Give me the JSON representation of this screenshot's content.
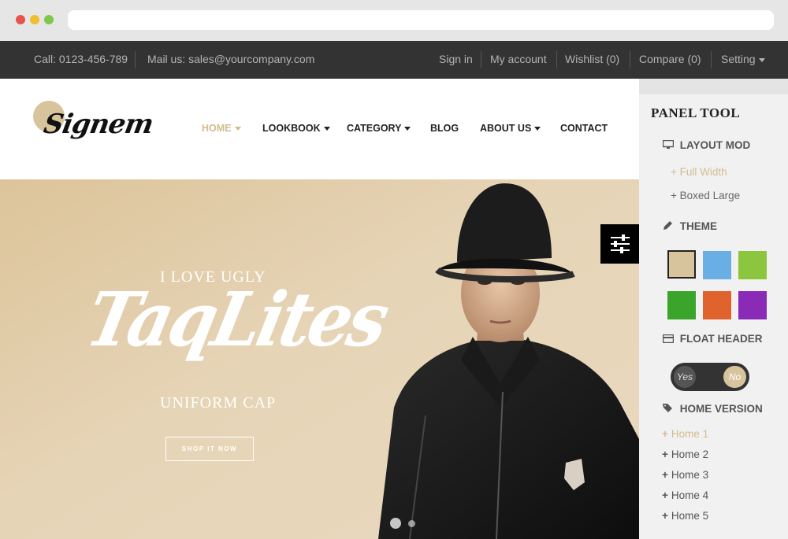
{
  "topbar": {
    "call": "Call: 0123-456-789",
    "mail": "Mail us: sales@yourcompany.com",
    "sign_in": "Sign in",
    "my_account": "My account",
    "wishlist": "Wishlist (0)",
    "compare": "Compare (0)",
    "setting": "Setting"
  },
  "header": {
    "logo": "Signem",
    "nav": [
      "HOME",
      "LOOKBOOK",
      "CATEGORY",
      "BLOG",
      "ABOUT US",
      "CONTACT"
    ]
  },
  "hero": {
    "line1": "I LOVE UGLY",
    "big": "TaqLites",
    "line3": "UNIFORM CAP",
    "button": "SHOP IT NOW"
  },
  "panel": {
    "title": "PANEL TOOL",
    "layout_heading": "LAYOUT MOD",
    "layout_options": [
      "+ Full Width",
      "+ Boxed Large"
    ],
    "theme_heading": "THEME",
    "theme_colors": [
      "#d8c49c",
      "#6aaee6",
      "#8cc63f",
      "#3aa52a",
      "#e0622c",
      "#8a2bb8"
    ],
    "float_heading": "FLOAT HEADER",
    "float_yes": "Yes",
    "float_no": "No",
    "home_heading": "HOME VERSION",
    "home_options": [
      "Home 1",
      "Home 2",
      "Home 3",
      "Home 4",
      "Home 5"
    ]
  },
  "colors": {
    "accent": "#d3bc8e",
    "topbar_bg": "#333333"
  }
}
